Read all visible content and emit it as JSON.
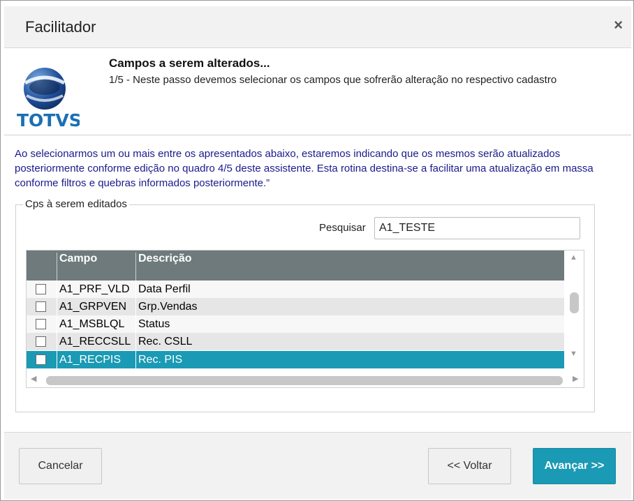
{
  "window": {
    "title": "Facilitador",
    "close_glyph": "×"
  },
  "header": {
    "brand": "TOTVS",
    "title": "Campos a serem alterados...",
    "subtitle": "1/5 - Neste passo devemos selecionar os campos que sofrerão alteração no respectivo cadastro"
  },
  "intro": {
    "text": "Ao selecionarmos um ou mais entre os apresentados abaixo, estaremos indicando que os mesmos serão atualizados posteriormente conforme edição no quadro 4/5 deste assistente. Esta rotina destina-se a facilitar uma atualização em massa conforme filtros e quebras informados posteriormente.”"
  },
  "group": {
    "legend": "Cps à serem editados",
    "search_label": "Pesquisar",
    "search_value": "A1_TESTE"
  },
  "grid": {
    "columns": [
      "",
      "Campo",
      "Descrição"
    ],
    "rows": [
      {
        "campo": "A1_PRF_VLD",
        "descricao": "Data Perfil",
        "checked": false,
        "selected": false
      },
      {
        "campo": "A1_GRPVEN",
        "descricao": "Grp.Vendas",
        "checked": false,
        "selected": false
      },
      {
        "campo": "A1_MSBLQL",
        "descricao": "Status",
        "checked": false,
        "selected": false
      },
      {
        "campo": "A1_RECCSLL",
        "descricao": "Rec. CSLL",
        "checked": false,
        "selected": false
      },
      {
        "campo": "A1_RECPIS",
        "descricao": "Rec. PIS",
        "checked": false,
        "selected": true
      }
    ]
  },
  "footer": {
    "cancel_label": "Cancelar",
    "back_prefix": "<< ",
    "back_label": "Voltar",
    "next_label": "Avançar >>"
  },
  "colors": {
    "accent": "#1a9ab4",
    "header_bg": "#6e7a7c",
    "intro_text": "#1a1a8c"
  }
}
